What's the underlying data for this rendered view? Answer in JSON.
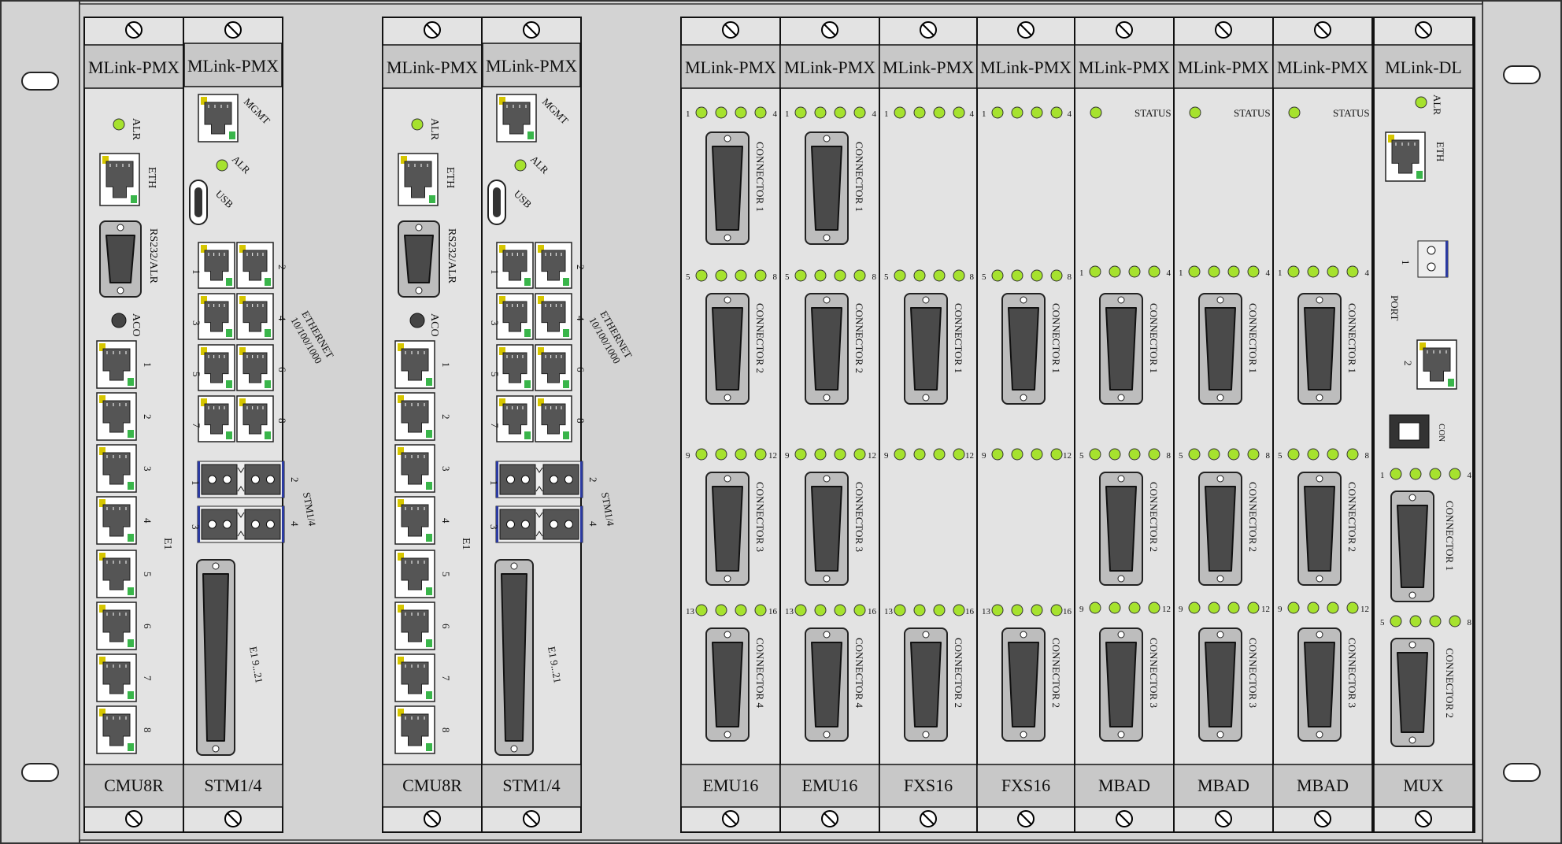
{
  "colors": {
    "led": "#a6e22e",
    "panel": "#e3e3e3",
    "label": "#c8c8c8",
    "frame": "#d3d3d3",
    "port_yellow": "#d6c600",
    "port_green": "#39b54a",
    "fiber_blue": "#2b3aa0"
  },
  "cards": [
    {
      "id": "cmu8r-1",
      "type": "cmu8r",
      "top": "MLink-PMX",
      "bottom": "CMU8R",
      "alr": "ALR",
      "eth": "ETH",
      "rs232": "RS232/ALR",
      "aco": "ACO",
      "e1": "E1",
      "ports": [
        "1",
        "2",
        "3",
        "4",
        "5",
        "6",
        "7",
        "8"
      ]
    },
    {
      "id": "stm14-1",
      "type": "stm14",
      "top": "MLink-PMX",
      "bottom": "STM1/4",
      "mgmt": "MGMT",
      "alr": "ALR",
      "usb": "USB",
      "ethernet": "ETHERNET",
      "ethernet_speed": "10/100/1000",
      "eth_ports": [
        "1",
        "2",
        "3",
        "4",
        "5",
        "6",
        "7",
        "8"
      ],
      "stm": "STM1/4",
      "stm_ports": [
        "1",
        "2",
        "3",
        "4"
      ],
      "e1": "E1 9...21"
    },
    {
      "id": "cmu8r-2",
      "type": "cmu8r",
      "top": "MLink-PMX",
      "bottom": "CMU8R",
      "alr": "ALR",
      "eth": "ETH",
      "rs232": "RS232/ALR",
      "aco": "ACO",
      "e1": "E1",
      "ports": [
        "1",
        "2",
        "3",
        "4",
        "5",
        "6",
        "7",
        "8"
      ]
    },
    {
      "id": "stm14-2",
      "type": "stm14",
      "top": "MLink-PMX",
      "bottom": "STM1/4",
      "mgmt": "MGMT",
      "alr": "ALR",
      "usb": "USB",
      "ethernet": "ETHERNET",
      "ethernet_speed": "10/100/1000",
      "eth_ports": [
        "1",
        "2",
        "3",
        "4",
        "5",
        "6",
        "7",
        "8"
      ],
      "stm": "STM1/4",
      "stm_ports": [
        "1",
        "2",
        "3",
        "4"
      ],
      "e1": "E1 9...21"
    },
    {
      "id": "emu16-1",
      "type": "emu16",
      "top": "MLink-PMX",
      "bottom": "EMU16",
      "groups": [
        [
          "1",
          "4"
        ],
        [
          "5",
          "8"
        ],
        [
          "9",
          "12"
        ],
        [
          "13",
          "16"
        ]
      ],
      "connectors": [
        "CONNECTOR 1",
        "CONNECTOR 2",
        "CONNECTOR 3",
        "CONNECTOR 4"
      ]
    },
    {
      "id": "emu16-2",
      "type": "emu16",
      "top": "MLink-PMX",
      "bottom": "EMU16",
      "groups": [
        [
          "1",
          "4"
        ],
        [
          "5",
          "8"
        ],
        [
          "9",
          "12"
        ],
        [
          "13",
          "16"
        ]
      ],
      "connectors": [
        "CONNECTOR 1",
        "CONNECTOR 2",
        "CONNECTOR 3",
        "CONNECTOR 4"
      ]
    },
    {
      "id": "fxs16-1",
      "type": "fxs16",
      "top": "MLink-PMX",
      "bottom": "FXS16",
      "groups": [
        [
          "1",
          "4"
        ],
        [
          "5",
          "8"
        ],
        [
          "9",
          "12"
        ],
        [
          "13",
          "16"
        ]
      ],
      "connectors": [
        "CONNECTOR 1",
        "CONNECTOR 2"
      ]
    },
    {
      "id": "fxs16-2",
      "type": "fxs16",
      "top": "MLink-PMX",
      "bottom": "FXS16",
      "groups": [
        [
          "1",
          "4"
        ],
        [
          "5",
          "8"
        ],
        [
          "9",
          "12"
        ],
        [
          "13",
          "16"
        ]
      ],
      "connectors": [
        "CONNECTOR 1",
        "CONNECTOR 2"
      ]
    },
    {
      "id": "mbad-1",
      "type": "mbad",
      "top": "MLink-PMX",
      "bottom": "MBAD",
      "status": "STATUS",
      "groups": [
        [
          "1",
          "4"
        ],
        [
          "5",
          "8"
        ],
        [
          "9",
          "12"
        ]
      ],
      "connectors": [
        "CONNECTOR 1",
        "CONNECTOR 2",
        "CONNECTOR 3"
      ]
    },
    {
      "id": "mbad-2",
      "type": "mbad",
      "top": "MLink-PMX",
      "bottom": "MBAD",
      "status": "STATUS",
      "groups": [
        [
          "1",
          "4"
        ],
        [
          "5",
          "8"
        ],
        [
          "9",
          "12"
        ]
      ],
      "connectors": [
        "CONNECTOR 1",
        "CONNECTOR 2",
        "CONNECTOR 3"
      ]
    },
    {
      "id": "mbad-3",
      "type": "mbad",
      "top": "MLink-PMX",
      "bottom": "MBAD",
      "status": "STATUS",
      "groups": [
        [
          "1",
          "4"
        ],
        [
          "5",
          "8"
        ],
        [
          "9",
          "12"
        ]
      ],
      "connectors": [
        "CONNECTOR 1",
        "CONNECTOR 2",
        "CONNECTOR 3"
      ]
    },
    {
      "id": "mux",
      "type": "mux",
      "top": "MLink-DL",
      "bottom": "MUX",
      "alr": "ALR",
      "eth": "ETH",
      "port": "PORT",
      "port_nums": [
        "1",
        "2"
      ],
      "con": "CON",
      "groups": [
        [
          "1",
          "4"
        ],
        [
          "5",
          "8"
        ]
      ],
      "connectors": [
        "CONNECTOR 1",
        "CONNECTOR 2"
      ]
    }
  ]
}
